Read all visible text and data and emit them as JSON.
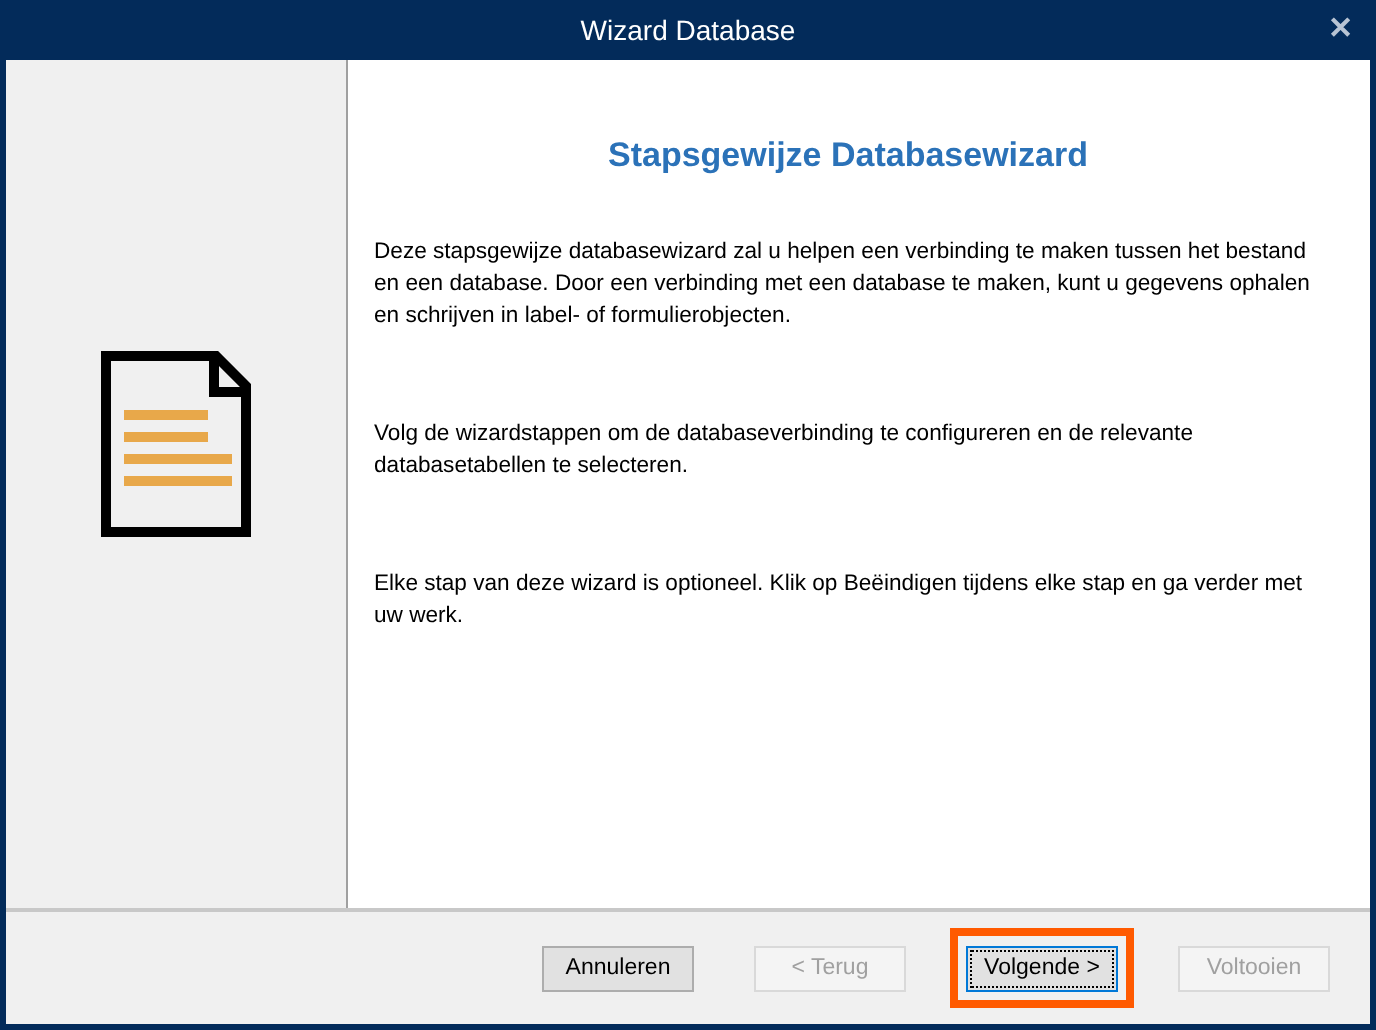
{
  "window": {
    "title": "Wizard Database",
    "close": "✕"
  },
  "heading": "Stapsgewijze Databasewizard",
  "paragraphs": [
    "Deze stapsgewijze databasewizard zal u helpen een verbinding te maken tussen het bestand en een database. Door een verbinding met een database te maken, kunt u gegevens ophalen en schrijven in label- of formulierobjecten.",
    "Volg de wizardstappen om de databaseverbinding te configureren en de relevante databasetabellen te selecteren.",
    "Elke stap van deze wizard is optioneel. Klik op Beëindigen tijdens elke stap en ga verder met uw werk."
  ],
  "buttons": [
    {
      "label": "Annuleren",
      "disabled": false,
      "focused": false,
      "highlighted": false
    },
    {
      "label": "< Terug",
      "disabled": true,
      "focused": false,
      "highlighted": false
    },
    {
      "label": "Volgende >",
      "disabled": false,
      "focused": true,
      "highlighted": true
    },
    {
      "label": "Voltooien",
      "disabled": true,
      "focused": false,
      "highlighted": false
    }
  ]
}
